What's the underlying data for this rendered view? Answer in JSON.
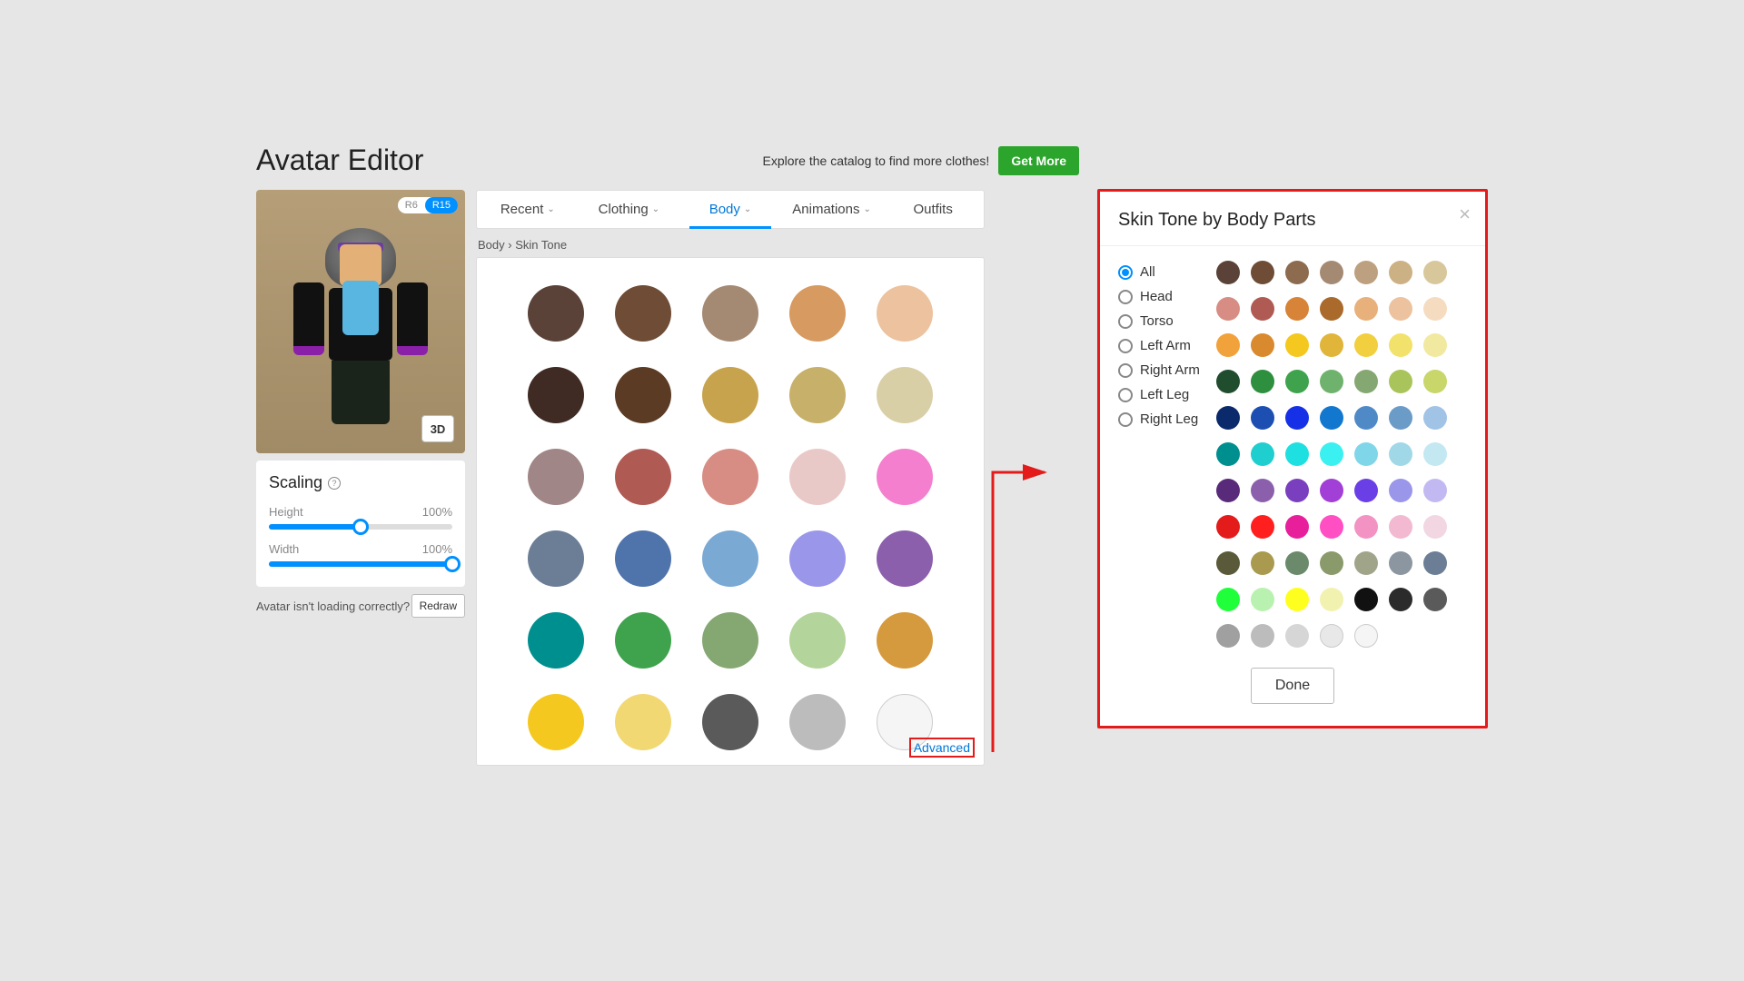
{
  "header": {
    "title": "Avatar Editor",
    "catalog_text": "Explore the catalog to find more clothes!",
    "get_more_label": "Get More"
  },
  "preview": {
    "rig_r6": "R6",
    "rig_r15": "R15",
    "btn_3d": "3D"
  },
  "scaling": {
    "title": "Scaling",
    "height_label": "Height",
    "height_value": "100%",
    "height_fill_pct": 50,
    "width_label": "Width",
    "width_value": "100%",
    "width_fill_pct": 100
  },
  "redraw": {
    "prompt": "Avatar isn't loading correctly?",
    "button": "Redraw"
  },
  "tabs": [
    {
      "label": "Recent",
      "has_menu": true,
      "active": false
    },
    {
      "label": "Clothing",
      "has_menu": true,
      "active": false
    },
    {
      "label": "Body",
      "has_menu": true,
      "active": true
    },
    {
      "label": "Animations",
      "has_menu": true,
      "active": false
    },
    {
      "label": "Outfits",
      "has_menu": false,
      "active": false
    }
  ],
  "breadcrumb": {
    "root": "Body",
    "sep": "›",
    "leaf": "Skin Tone"
  },
  "main_swatches": [
    "#5a4238",
    "#6e4c35",
    "#a58a73",
    "#d79a60",
    "#edc29e",
    "#3f2b23",
    "#5b3b24",
    "#c7a34d",
    "#c7b06a",
    "#d9cfa6",
    "#a08686",
    "#b05a54",
    "#d78d84",
    "#e9c9c7",
    "#f47fce",
    "#6b7e96",
    "#4f73ab",
    "#7aa9d4",
    "#9a96ea",
    "#8c5fad",
    "#008f8f",
    "#3fa34d",
    "#85a873",
    "#b3d49a",
    "#d69a3e",
    "#f4c81f",
    "#f2d873",
    "#5a5a5a",
    "#bcbcbc",
    "#f5f5f5"
  ],
  "advanced_label": "Advanced",
  "dialog": {
    "title": "Skin Tone by Body Parts",
    "body_parts": [
      "All",
      "Head",
      "Torso",
      "Left Arm",
      "Right Arm",
      "Left Leg",
      "Right Leg"
    ],
    "selected_index": 0,
    "done_label": "Done",
    "swatches": [
      "#5a4238",
      "#6e4c35",
      "#8c6b4e",
      "#a58a73",
      "#bca07f",
      "#ccb184",
      "#d8c79a",
      "#d78d84",
      "#b05a54",
      "#d78338",
      "#aa6a2b",
      "#e8b07a",
      "#edc29e",
      "#f5dcc0",
      "#f2a23a",
      "#d98a2e",
      "#f4c81f",
      "#e0b53a",
      "#f2cf3f",
      "#f2e26b",
      "#f2e9a0",
      "#1f4d2e",
      "#2e8f3f",
      "#3fa34d",
      "#6fb26d",
      "#85a873",
      "#a9c45a",
      "#c8d66a",
      "#0b2a6b",
      "#1d4fb3",
      "#1530e6",
      "#1177cf",
      "#4f8ac7",
      "#6b9bc7",
      "#a0c3e6",
      "#008f8f",
      "#1fcfcf",
      "#1fe0e0",
      "#3bf0f0",
      "#7fd6e8",
      "#a0d8e8",
      "#c3e8f2",
      "#5a2a7a",
      "#8c5fad",
      "#7a3fbf",
      "#a23fd6",
      "#6b3fe6",
      "#9a96ea",
      "#c3b9f2",
      "#e31b1b",
      "#ff1f1f",
      "#e81f9a",
      "#ff4fc3",
      "#f293c3",
      "#f2b9d1",
      "#f2d6e2",
      "#5a5a3a",
      "#a99a4f",
      "#6b8a6b",
      "#8a9a6b",
      "#a0a58a",
      "#8c96a0",
      "#6b7e96",
      "#1fff3a",
      "#b9f2b0",
      "#ffff1f",
      "#f2f2b0",
      "#111111",
      "#2b2b2b",
      "#5a5a5a",
      "#a0a0a0",
      "#bcbcbc",
      "#d6d6d6",
      "#e8e8e8",
      "#f5f5f5"
    ]
  }
}
